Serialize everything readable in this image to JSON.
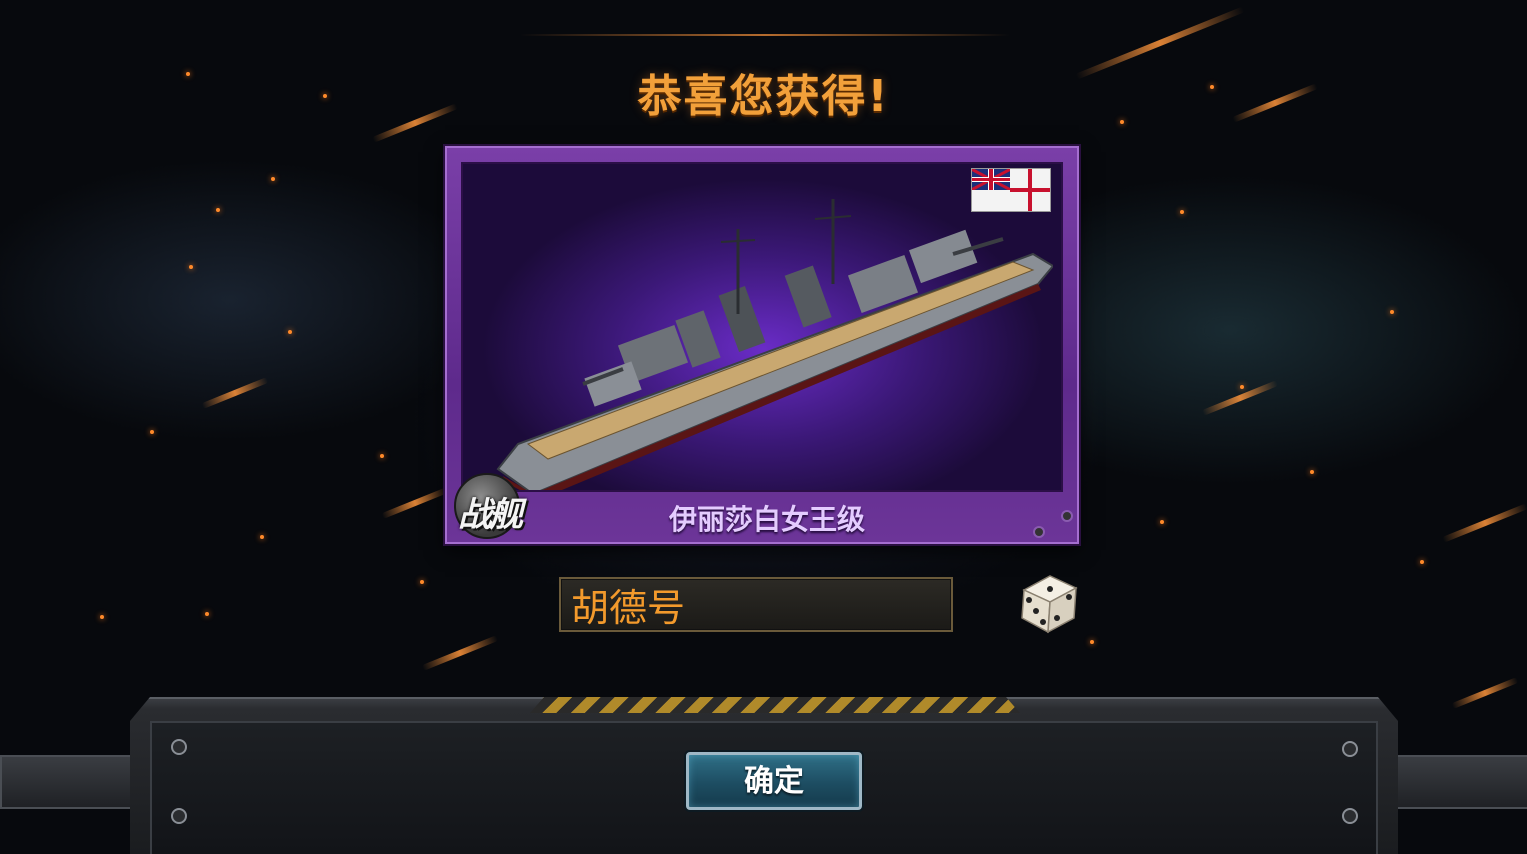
{
  "dialog": {
    "title": "恭喜您获得!",
    "ship": {
      "type_label": "战舰",
      "class_name": "伊丽莎白女王级",
      "flag": "uk-white-ensign"
    },
    "name_field": {
      "value": "胡德号"
    },
    "random_name_icon": "dice-icon",
    "confirm_label": "确定"
  },
  "colors": {
    "title": "#f2a03a",
    "card_frame": "#6c3598",
    "name_text": "#f39a2c",
    "button": "#1d4d62"
  }
}
